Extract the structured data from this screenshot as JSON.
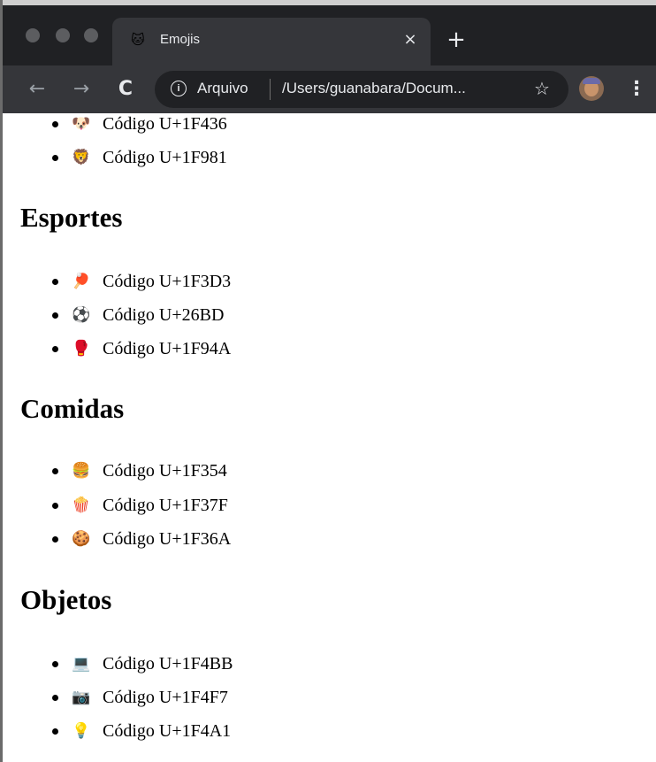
{
  "browser": {
    "tab": {
      "favicon": "🐱",
      "title": "Emojis",
      "close_glyph": "×"
    },
    "new_tab_glyph": "+",
    "nav": {
      "back_glyph": "←",
      "forward_glyph": "→",
      "reload_glyph": "C"
    },
    "address": {
      "info_glyph": "i",
      "scheme_label": "Arquivo",
      "url_text": "/Users/guanabara/Docum..."
    },
    "star_glyph": "☆",
    "menu_glyph": "⋮"
  },
  "top_items": [
    {
      "emoji": "🐶",
      "emoji_name": "dog-face-icon",
      "text": "Código U+1F436"
    },
    {
      "emoji": "🦁",
      "emoji_name": "lion-face-icon",
      "text": "Código U+1F981"
    }
  ],
  "sections": [
    {
      "heading": "Esportes",
      "items": [
        {
          "emoji": "🏓",
          "emoji_name": "ping-pong-icon",
          "text": "Código U+1F3D3"
        },
        {
          "emoji": "⚽",
          "emoji_name": "soccer-ball-icon",
          "text": "Código U+26BD"
        },
        {
          "emoji": "🥊",
          "emoji_name": "boxing-glove-icon",
          "text": "Código U+1F94A"
        }
      ]
    },
    {
      "heading": "Comidas",
      "items": [
        {
          "emoji": "🍔",
          "emoji_name": "hamburger-icon",
          "text": "Código U+1F354"
        },
        {
          "emoji": "🍿",
          "emoji_name": "popcorn-icon",
          "text": "Código U+1F37F"
        },
        {
          "emoji": "🍪",
          "emoji_name": "cookie-icon",
          "text": "Código U+1F36A"
        }
      ]
    },
    {
      "heading": "Objetos",
      "items": [
        {
          "emoji": "💻",
          "emoji_name": "laptop-icon",
          "text": "Código U+1F4BB"
        },
        {
          "emoji": "📷",
          "emoji_name": "camera-icon",
          "text": "Código U+1F4F7"
        },
        {
          "emoji": "💡",
          "emoji_name": "light-bulb-icon",
          "text": "Código U+1F4A1"
        }
      ]
    }
  ],
  "colors": {
    "chrome_dark": "#202124",
    "toolbar": "#35363a",
    "text_light": "#e8eaed",
    "page_bg": "#ffffff"
  }
}
